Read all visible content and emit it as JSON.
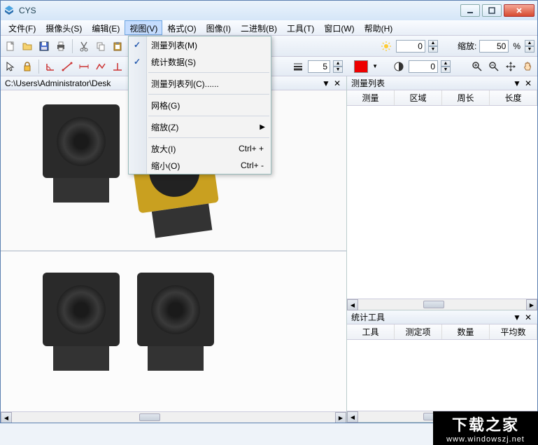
{
  "app": {
    "title": "CYS"
  },
  "menus": {
    "file": "文件(F)",
    "camera": "摄像头(S)",
    "edit": "编辑(E)",
    "view": "视图(V)",
    "format": "格式(O)",
    "image": "图像(I)",
    "binary": "二进制(B)",
    "tool": "工具(T)",
    "window": "窗口(W)",
    "help": "帮助(H)"
  },
  "view_menu": {
    "measure_list": "测量列表(M)",
    "stat_data": "统计数据(S)",
    "measure_cols": "测量列表列(C)......",
    "grid": "网格(G)",
    "zoom": "缩放(Z)",
    "zoom_in": "放大(I)",
    "zoom_in_key": "Ctrl+ +",
    "zoom_out": "缩小(O)",
    "zoom_out_key": "Ctrl+ -"
  },
  "toolbar": {
    "brightness_value": "0",
    "zoom_label": "缩放:",
    "zoom_value": "50",
    "zoom_unit": "%",
    "contrast_value": "0",
    "line_width": "5"
  },
  "left_pane": {
    "path": "C:\\Users\\Administrator\\Desk"
  },
  "panel_measure": {
    "title": "测量列表",
    "cols": [
      "测量",
      "区域",
      "周长",
      "长度"
    ]
  },
  "panel_stats": {
    "title": "统计工具",
    "cols": [
      "工具",
      "测定项",
      "数量",
      "平均数"
    ]
  },
  "watermark": {
    "big": "下载之家",
    "small": "www.windowszj.net"
  }
}
